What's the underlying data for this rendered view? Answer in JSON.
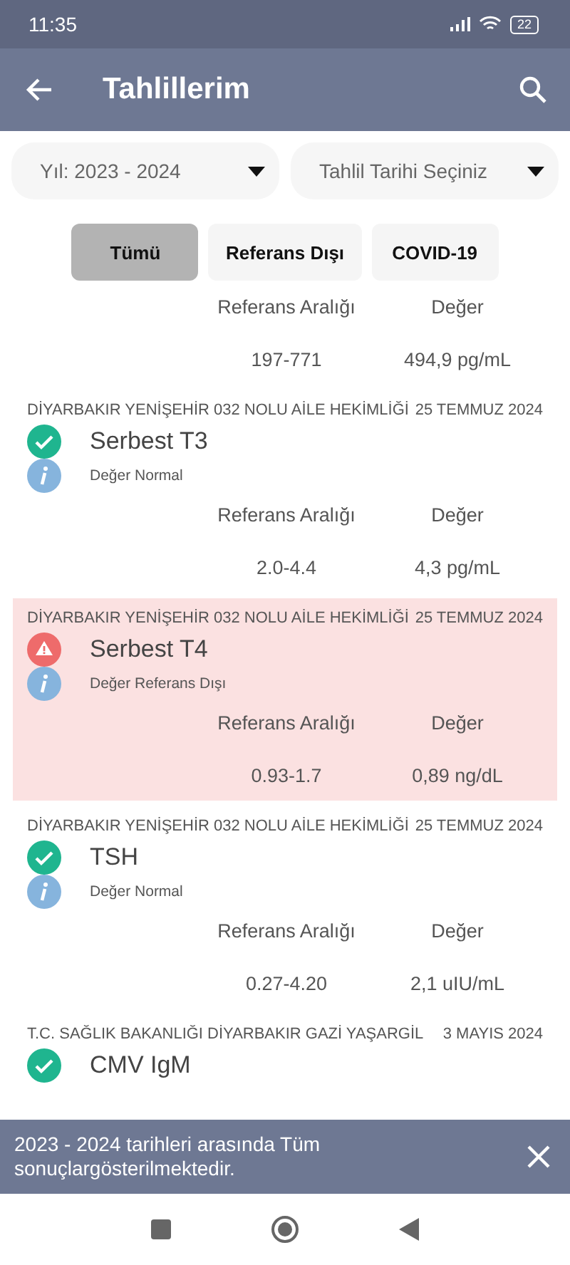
{
  "status_bar": {
    "time": "11:35",
    "battery": "22"
  },
  "app_bar": {
    "title": "Tahlillerim"
  },
  "filters": [
    {
      "value": "Yıl: 2023 - 2024"
    },
    {
      "value": "Tahlil Tarihi Seçiniz"
    }
  ],
  "chips": [
    {
      "label": "Tümü",
      "selected": true
    },
    {
      "label": "Referans Dışı",
      "selected": false
    },
    {
      "label": "COVID-19",
      "selected": false
    }
  ],
  "results": [
    {
      "kind": "partial",
      "range_label": "Referans Aralığı",
      "value_label": "Değer",
      "range": "197-771",
      "value": "494,9 pg/mL"
    },
    {
      "kind": "full",
      "institution": "DİYARBAKIR YENİŞEHİR 032 NOLU AİLE HEKİMLİĞİ",
      "date": "25 TEMMUZ 2024",
      "test": "Serbest T3",
      "status": "Değer Normal",
      "out_of_range": false,
      "range_label": "Referans Aralığı",
      "value_label": "Değer",
      "range": "2.0-4.4",
      "value": "4,3 pg/mL"
    },
    {
      "kind": "full",
      "institution": "DİYARBAKIR YENİŞEHİR 032 NOLU AİLE HEKİMLİĞİ",
      "date": "25 TEMMUZ 2024",
      "test": "Serbest T4",
      "status": "Değer Referans Dışı",
      "out_of_range": true,
      "range_label": "Referans Aralığı",
      "value_label": "Değer",
      "range": "0.93-1.7",
      "value": "0,89 ng/dL"
    },
    {
      "kind": "full",
      "institution": "DİYARBAKIR YENİŞEHİR 032 NOLU AİLE HEKİMLİĞİ",
      "date": "25 TEMMUZ 2024",
      "test": "TSH",
      "status": "Değer Normal",
      "out_of_range": false,
      "range_label": "Referans Aralığı",
      "value_label": "Değer",
      "range": "0.27-4.20",
      "value": "2,1 uIU/mL"
    },
    {
      "kind": "full",
      "institution": "T.C. SAĞLIK BAKANLIĞI DİYARBAKIR GAZİ YAŞARGİL",
      "date": "3 MAYIS 2024",
      "test": "CMV IgM",
      "out_of_range": false
    }
  ],
  "snackbar": {
    "message": "2023 - 2024 tarihleri arasında Tüm sonuçlargösterilmektedir."
  }
}
